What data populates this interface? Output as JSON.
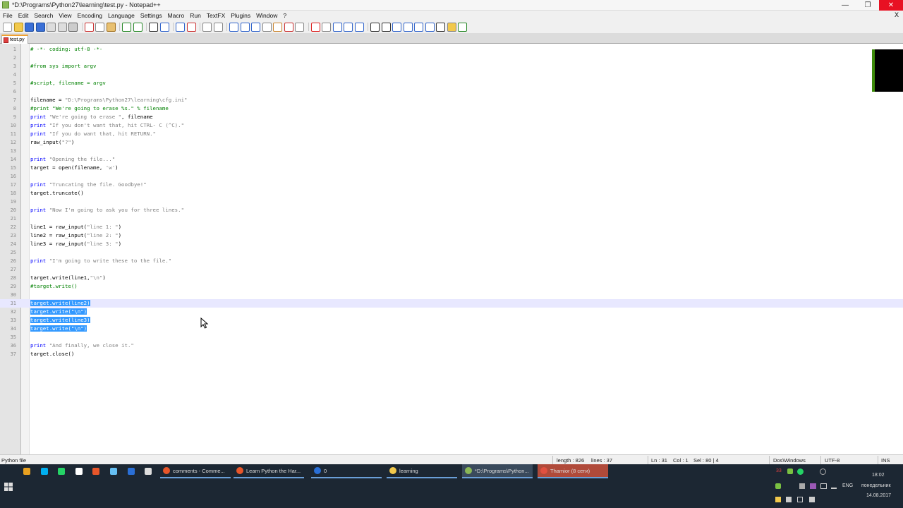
{
  "window": {
    "title": "*D:\\Programs\\Python27\\learning\\test.py - Notepad++"
  },
  "menu": [
    "File",
    "Edit",
    "Search",
    "View",
    "Encoding",
    "Language",
    "Settings",
    "Macro",
    "Run",
    "TextFX",
    "Plugins",
    "Window",
    "?"
  ],
  "menu_close": "X",
  "tab": {
    "label": "test.py"
  },
  "lines": [
    {
      "n": "1",
      "t": [
        [
          "cm",
          "# -*- coding: utf-8 -*-"
        ]
      ]
    },
    {
      "n": "2",
      "t": []
    },
    {
      "n": "3",
      "t": [
        [
          "cm",
          "#from sys import argv"
        ]
      ]
    },
    {
      "n": "4",
      "t": []
    },
    {
      "n": "5",
      "t": [
        [
          "cm",
          "#script, filename = argv"
        ]
      ]
    },
    {
      "n": "6",
      "t": []
    },
    {
      "n": "7",
      "t": [
        [
          "p",
          "filename = "
        ],
        [
          "str",
          "\"D:\\Programs\\Python27\\learning\\cfg.ini\""
        ]
      ]
    },
    {
      "n": "8",
      "t": [
        [
          "cm",
          "#print \"We're going to erase %s.\" % filename"
        ]
      ]
    },
    {
      "n": "9",
      "t": [
        [
          "kw",
          "print"
        ],
        [
          "p",
          " "
        ],
        [
          "str",
          "\"We're going to erase \""
        ],
        [
          "p",
          ", filename"
        ]
      ]
    },
    {
      "n": "10",
      "t": [
        [
          "kw",
          "print"
        ],
        [
          "p",
          " "
        ],
        [
          "str",
          "\"If you don't want that, hit CTRL- C (^C).\""
        ]
      ]
    },
    {
      "n": "11",
      "t": [
        [
          "kw",
          "print"
        ],
        [
          "p",
          " "
        ],
        [
          "str",
          "\"If you do want that, hit RETURN.\""
        ]
      ]
    },
    {
      "n": "12",
      "t": [
        [
          "p",
          "raw_input("
        ],
        [
          "str",
          "\"?\""
        ],
        [
          "p",
          ")"
        ]
      ]
    },
    {
      "n": "13",
      "t": []
    },
    {
      "n": "14",
      "t": [
        [
          "kw",
          "print"
        ],
        [
          "p",
          " "
        ],
        [
          "str",
          "\"Opening the file...\""
        ]
      ]
    },
    {
      "n": "15",
      "t": [
        [
          "p",
          "target = open(filename, "
        ],
        [
          "str",
          "'w'"
        ],
        [
          "p",
          ")"
        ]
      ]
    },
    {
      "n": "16",
      "t": []
    },
    {
      "n": "17",
      "t": [
        [
          "kw",
          "print"
        ],
        [
          "p",
          " "
        ],
        [
          "str",
          "\"Truncating the file. Goodbye!\""
        ]
      ]
    },
    {
      "n": "18",
      "t": [
        [
          "p",
          "target.truncate()"
        ]
      ]
    },
    {
      "n": "19",
      "t": []
    },
    {
      "n": "20",
      "t": [
        [
          "kw",
          "print"
        ],
        [
          "p",
          " "
        ],
        [
          "str",
          "\"Now I'm going to ask you for three lines.\""
        ]
      ]
    },
    {
      "n": "21",
      "t": []
    },
    {
      "n": "22",
      "t": [
        [
          "p",
          "line1 = raw_input("
        ],
        [
          "str",
          "\"line 1: \""
        ],
        [
          "p",
          ")"
        ]
      ]
    },
    {
      "n": "23",
      "t": [
        [
          "p",
          "line2 = raw_input("
        ],
        [
          "str",
          "\"line 2: \""
        ],
        [
          "p",
          ")"
        ]
      ]
    },
    {
      "n": "24",
      "t": [
        [
          "p",
          "line3 = raw_input("
        ],
        [
          "str",
          "\"line 3: \""
        ],
        [
          "p",
          ")"
        ]
      ]
    },
    {
      "n": "25",
      "t": []
    },
    {
      "n": "26",
      "t": [
        [
          "kw",
          "print"
        ],
        [
          "p",
          " "
        ],
        [
          "str",
          "\"I'm going to write these to the file.\""
        ]
      ]
    },
    {
      "n": "27",
      "t": []
    },
    {
      "n": "28",
      "t": [
        [
          "p",
          "target.write(line1,"
        ],
        [
          "str",
          "\"\\n\""
        ],
        [
          "p",
          ")"
        ]
      ]
    },
    {
      "n": "29",
      "t": [
        [
          "cm",
          "#target.write()"
        ]
      ]
    },
    {
      "n": "30",
      "t": []
    },
    {
      "n": "31",
      "t": [
        [
          "sel",
          "target.write(line2)"
        ]
      ]
    },
    {
      "n": "32",
      "t": [
        [
          "sel",
          "target.write(\"\\n\")"
        ]
      ]
    },
    {
      "n": "33",
      "t": [
        [
          "sel",
          "target.write(line3)"
        ]
      ]
    },
    {
      "n": "34",
      "t": [
        [
          "sel",
          "target.write(\"\\n\")"
        ]
      ]
    },
    {
      "n": "35",
      "t": []
    },
    {
      "n": "36",
      "t": [
        [
          "kw",
          "print"
        ],
        [
          "p",
          " "
        ],
        [
          "str",
          "\"And finally, we close it.\""
        ]
      ]
    },
    {
      "n": "37",
      "t": [
        [
          "p",
          "target.close()"
        ]
      ]
    }
  ],
  "current_line": "31",
  "status": {
    "filetype": "Python file",
    "length": "length : 826",
    "lines": "lines : 37",
    "ln": "Ln : 31",
    "col": "Col : 1",
    "sel": "Sel : 80 | 4",
    "eol": "Dos\\Windows",
    "encoding": "UTF-8",
    "mode": "INS"
  },
  "taskbar": {
    "items": [
      {
        "label": "comments - Comme...",
        "color": "#e8562a"
      },
      {
        "label": "Learn Python the Har...",
        "color": "#e8562a"
      },
      {
        "label": "0",
        "color": "#2a6fd6"
      },
      {
        "label": "learning",
        "color": "#f2c94c"
      },
      {
        "label": "*D:\\Programs\\Python...",
        "color": "#8bb857"
      },
      {
        "label": "Thamior (8 сети)",
        "color": "#e05040"
      }
    ],
    "lang": "ENG",
    "time": "18:02",
    "day": "понедельник",
    "date": "14.08.2017",
    "badge": "33"
  },
  "colors": {
    "accent": "#3399ff",
    "keyword": "#0000ff",
    "string": "#808080",
    "comment": "#008000",
    "taskbar": "#1c2733"
  }
}
